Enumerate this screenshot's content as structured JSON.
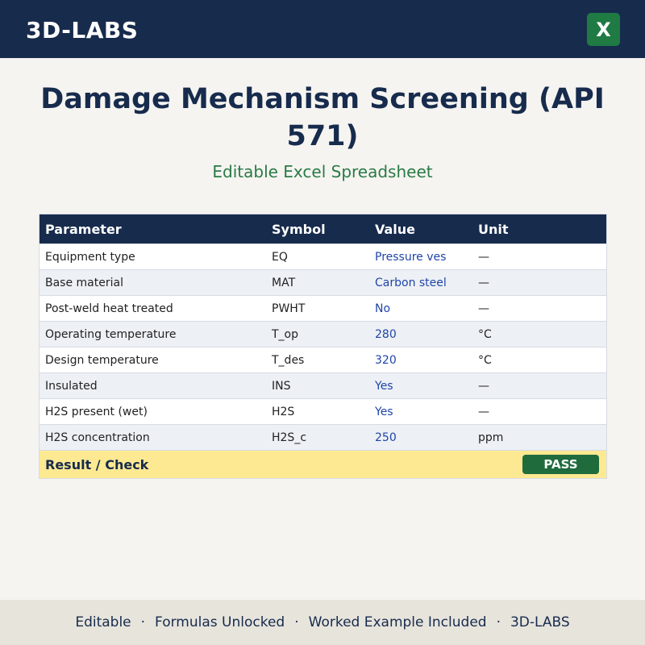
{
  "header": {
    "brand": "3D-LABS",
    "app_icon_letter": "X"
  },
  "title": "Damage Mechanism Screening (API 571)",
  "subtitle": "Editable Excel Spreadsheet",
  "table": {
    "columns": [
      "Parameter",
      "Symbol",
      "Value",
      "Unit"
    ],
    "rows": [
      {
        "parameter": "Equipment type",
        "symbol": "EQ",
        "value": "Pressure ves",
        "unit": "—"
      },
      {
        "parameter": "Base material",
        "symbol": "MAT",
        "value": "Carbon steel",
        "unit": "—"
      },
      {
        "parameter": "Post-weld heat treated",
        "symbol": "PWHT",
        "value": "No",
        "unit": "—"
      },
      {
        "parameter": "Operating temperature",
        "symbol": "T_op",
        "value": "280",
        "unit": "°C"
      },
      {
        "parameter": "Design temperature",
        "symbol": "T_des",
        "value": "320",
        "unit": "°C"
      },
      {
        "parameter": "Insulated",
        "symbol": "INS",
        "value": "Yes",
        "unit": "—"
      },
      {
        "parameter": "H2S present (wet)",
        "symbol": "H2S",
        "value": "Yes",
        "unit": "—"
      },
      {
        "parameter": "H2S concentration",
        "symbol": "H2S_c",
        "value": "250",
        "unit": "ppm"
      }
    ],
    "result_label": "Result / Check",
    "result_status": "PASS"
  },
  "footer": {
    "items": [
      "Editable",
      "Formulas Unlocked",
      "Worked Example Included",
      "3D-LABS"
    ],
    "separator": "·"
  },
  "colors": {
    "navy": "#172b4d",
    "excel_green": "#1f7a44",
    "pass_green": "#1f6b3c",
    "value_blue": "#1f45a8",
    "result_yellow": "#fde992"
  }
}
